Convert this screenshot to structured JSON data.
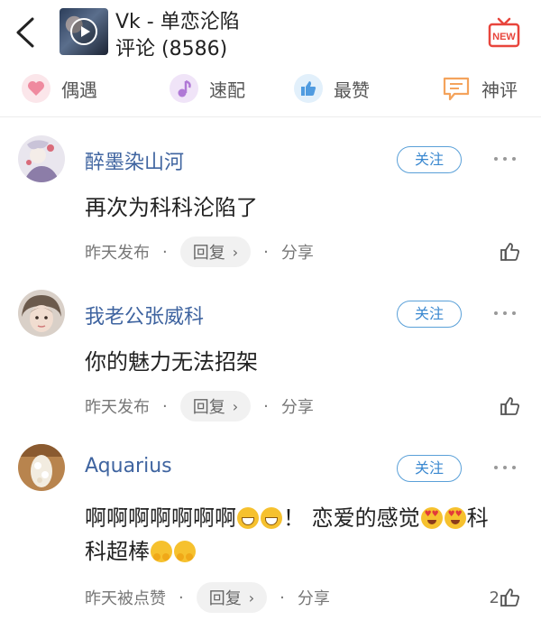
{
  "header": {
    "title": "Vk - 单恋沦陷",
    "subtitle": "评论 (8586)",
    "new_badge": "NEW"
  },
  "tabs": [
    {
      "label": "偶遇",
      "icon": "heart-icon",
      "color": "#f2a3b3"
    },
    {
      "label": "速配",
      "icon": "music-note-icon",
      "color": "#b98ad8"
    },
    {
      "label": "最赞",
      "icon": "thumbs-up-icon",
      "color": "#5aa7e8"
    },
    {
      "label": "神评",
      "icon": "chat-bubble-icon",
      "color": "#f4a35c"
    }
  ],
  "comments": [
    {
      "username": "醉墨染山河",
      "follow_label": "关注",
      "text": "再次为科科沦陷了",
      "time": "昨天发布",
      "reply_label": "回复",
      "share_label": "分享",
      "likes": ""
    },
    {
      "username": "我老公张威科",
      "follow_label": "关注",
      "text": "你的魅力无法招架",
      "time": "昨天发布",
      "reply_label": "回复",
      "share_label": "分享",
      "likes": ""
    },
    {
      "username": "Aquarius",
      "follow_label": "关注",
      "text_line1_a": "啊啊啊啊啊啊啊",
      "text_line1_b": "！ 恋爱的感觉",
      "text_line1_c": "科",
      "text_line2": "科超棒",
      "time": "昨天被点赞",
      "reply_label": "回复",
      "share_label": "分享",
      "likes": "2"
    }
  ],
  "colors": {
    "username": "#3f64a0",
    "follow_border": "#5aa0d8",
    "new_badge": "#e8453c"
  }
}
